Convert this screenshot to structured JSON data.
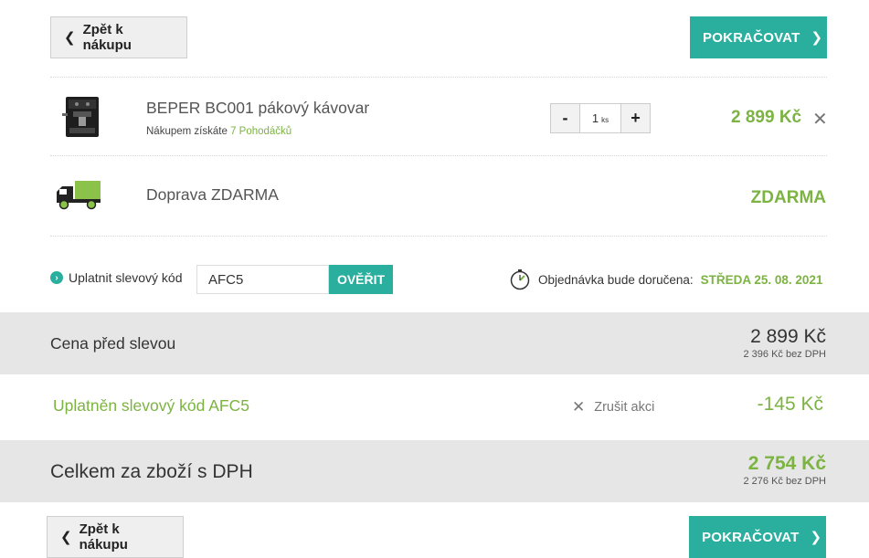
{
  "nav": {
    "back_label": "Zpět k nákupu",
    "next_label": "POKRAČOVAT"
  },
  "product": {
    "name": "BEPER BC001 pákový kávovar",
    "points_prefix": "Nákupem získáte",
    "points_value": "7 Pohodáčků",
    "quantity": "1",
    "quantity_unit": "ks",
    "price": "2 899 Kč",
    "minus": "-",
    "plus": "+",
    "remove": "✕"
  },
  "shipping": {
    "name": "Doprava ZDARMA",
    "price": "ZDARMA"
  },
  "coupon": {
    "label": "Uplatnit slevový kód",
    "value": "AFC5",
    "button": "OVĚŘIT"
  },
  "delivery": {
    "text": "Objednávka bude doručena:",
    "date": "STŘEDA 25. 08. 2021"
  },
  "summary": {
    "before_label": "Cena před slevou",
    "before_price": "2 899 Kč",
    "before_sub": "2 396 Kč bez DPH",
    "discount_label": "Uplatněn slevový kód AFC5",
    "cancel_label": "Zrušit akci",
    "discount_price": "-145 Kč",
    "total_label": "Celkem za zboží s DPH",
    "total_price": "2 754 Kč",
    "total_sub": "2 276 Kč bez DPH"
  },
  "colors": {
    "accent": "#2aaf9e",
    "green": "#7cb342",
    "band": "#e6e6e6"
  }
}
